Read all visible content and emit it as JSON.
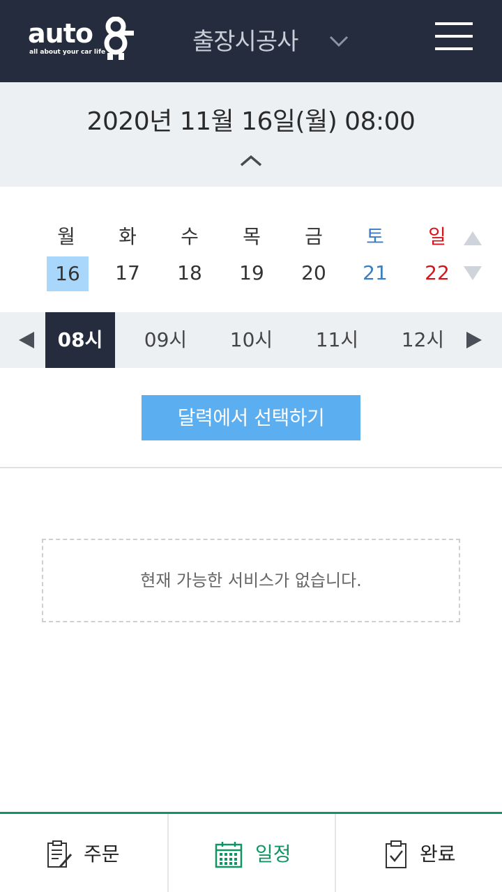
{
  "header": {
    "logo_word": "auto",
    "logo_tagline": "all about your car life",
    "service_title": "출장시공사",
    "icons": {
      "caret": "chevron-down-icon",
      "menu": "hamburger-menu-icon"
    }
  },
  "date_panel": {
    "selected_datetime": "2020년  11월  16일(월)  08:00",
    "collapse_icon": "chevron-up-icon"
  },
  "week": {
    "days": [
      {
        "name": "월",
        "num": "16",
        "type": "weekday",
        "selected": true
      },
      {
        "name": "화",
        "num": "17",
        "type": "weekday",
        "selected": false
      },
      {
        "name": "수",
        "num": "18",
        "type": "weekday",
        "selected": false
      },
      {
        "name": "목",
        "num": "19",
        "type": "weekday",
        "selected": false
      },
      {
        "name": "금",
        "num": "20",
        "type": "weekday",
        "selected": false
      },
      {
        "name": "토",
        "num": "21",
        "type": "saturday",
        "selected": false
      },
      {
        "name": "일",
        "num": "22",
        "type": "sunday",
        "selected": false
      }
    ],
    "colors": {
      "saturday": "#3a7dc0",
      "sunday": "#d7141b",
      "selected_bg": "#a9d6fb"
    }
  },
  "hours": {
    "items": [
      "08시",
      "09시",
      "10시",
      "11시",
      "12시"
    ],
    "active_index": 0
  },
  "calendar_button": {
    "label": "달력에서 선택하기"
  },
  "empty_state": {
    "message": "현재 가능한 서비스가 없습니다."
  },
  "bottom_nav": {
    "items": [
      {
        "label": "주문",
        "icon": "order-form-icon",
        "active": false
      },
      {
        "label": "일정",
        "icon": "calendar-icon",
        "active": true
      },
      {
        "label": "완료",
        "icon": "clipboard-check-icon",
        "active": false
      }
    ],
    "accent_color": "#119363"
  },
  "theme": {
    "header_bg": "#252c3d",
    "panel_bg": "#edf0f3",
    "button_bg": "#5baef0"
  }
}
